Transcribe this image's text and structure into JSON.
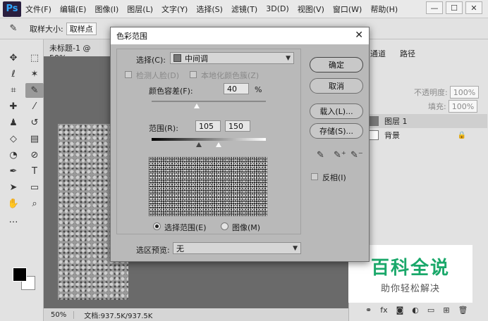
{
  "app": {
    "logo": "Ps",
    "menu": [
      "文件(F)",
      "编辑(E)",
      "图像(I)",
      "图层(L)",
      "文字(Y)",
      "选择(S)",
      "滤镜(T)",
      "3D(D)",
      "视图(V)",
      "窗口(W)",
      "帮助(H)"
    ],
    "window_buttons": [
      "—",
      "☐",
      "✕"
    ]
  },
  "options": {
    "sample_size_label": "取样大小:",
    "sample_size_value": "取样点"
  },
  "document": {
    "tab_title": "未标题-1 @ 50%",
    "zoom": "50%",
    "doc_info": "文档:937.5K/937.5K"
  },
  "layers_panel": {
    "tabs": [
      "通道",
      "路径"
    ],
    "opacity_label": "不透明度:",
    "opacity_value": "100%",
    "fill_label": "填充:",
    "fill_value": "100%",
    "layers": [
      {
        "name": "图层 1"
      },
      {
        "name": "背景"
      }
    ]
  },
  "dialog": {
    "title": "色彩范围",
    "select_label": "选择(C):",
    "select_value": "中间调",
    "detect_faces": "检测人脸(D)",
    "localized_color": "本地化颜色簇(Z)",
    "fuzziness_label": "颜色容差(F):",
    "fuzziness_value": "40",
    "fuzziness_unit": "%",
    "range_label": "范围(R):",
    "range_low": "105",
    "range_high": "150",
    "radio_selection": "选择范围(E)",
    "radio_image": "图像(M)",
    "preview_label": "选区预览:",
    "preview_value": "无",
    "buttons": {
      "ok": "确定",
      "cancel": "取消",
      "load": "载入(L)...",
      "save": "存储(S)..."
    },
    "invert_label": "反相(I)",
    "close": "✕"
  },
  "watermark": {
    "title": "百科全说",
    "subtitle": "助你轻松解决"
  }
}
